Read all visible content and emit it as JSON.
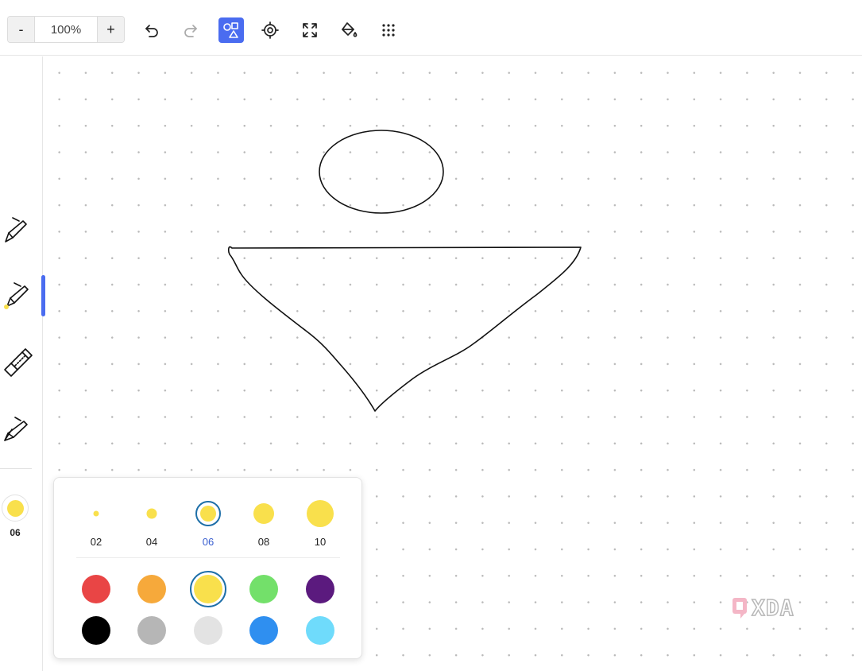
{
  "toolbar": {
    "zoom_out_label": "-",
    "zoom_value": "100%",
    "zoom_in_label": "+",
    "tools": [
      {
        "name": "undo-icon",
        "active": false
      },
      {
        "name": "redo-icon",
        "active": false
      },
      {
        "name": "shapes-icon",
        "active": true
      },
      {
        "name": "locate-icon",
        "active": false
      },
      {
        "name": "fit-screen-icon",
        "active": false
      },
      {
        "name": "fill-bucket-icon",
        "active": false
      },
      {
        "name": "grid-dots-icon",
        "active": false
      }
    ]
  },
  "sidebar": {
    "pens": [
      {
        "name": "pen-tool",
        "icon": "pen-icon",
        "active": false
      },
      {
        "name": "highlighter-tool",
        "icon": "highlighter-icon",
        "active": true
      },
      {
        "name": "eraser-tool",
        "icon": "eraser-icon",
        "active": false
      },
      {
        "name": "lasso-pen-tool",
        "icon": "calligraphy-pen-icon",
        "active": false
      }
    ],
    "current_color": "#f9e04c",
    "current_size": "06"
  },
  "palette": {
    "sizes": [
      {
        "label": "02",
        "selected": false
      },
      {
        "label": "04",
        "selected": false
      },
      {
        "label": "06",
        "selected": true
      },
      {
        "label": "08",
        "selected": false
      },
      {
        "label": "10",
        "selected": false
      }
    ],
    "colors": [
      {
        "name": "red",
        "hex": "#e94545",
        "selected": false
      },
      {
        "name": "orange",
        "hex": "#f6a93b",
        "selected": false
      },
      {
        "name": "yellow",
        "hex": "#f9e04c",
        "selected": true
      },
      {
        "name": "green",
        "hex": "#73e06a",
        "selected": false
      },
      {
        "name": "purple",
        "hex": "#5b1a7e",
        "selected": false
      },
      {
        "name": "black",
        "hex": "#000000",
        "selected": false
      },
      {
        "name": "gray",
        "hex": "#b6b6b6",
        "selected": false
      },
      {
        "name": "light-gray",
        "hex": "#e3e3e3",
        "selected": false
      },
      {
        "name": "blue",
        "hex": "#2f8ff0",
        "selected": false
      },
      {
        "name": "cyan",
        "hex": "#6fdbfb",
        "selected": false
      }
    ]
  },
  "accent_color": "#4a6cf0",
  "watermark": {
    "text": "XDA"
  }
}
